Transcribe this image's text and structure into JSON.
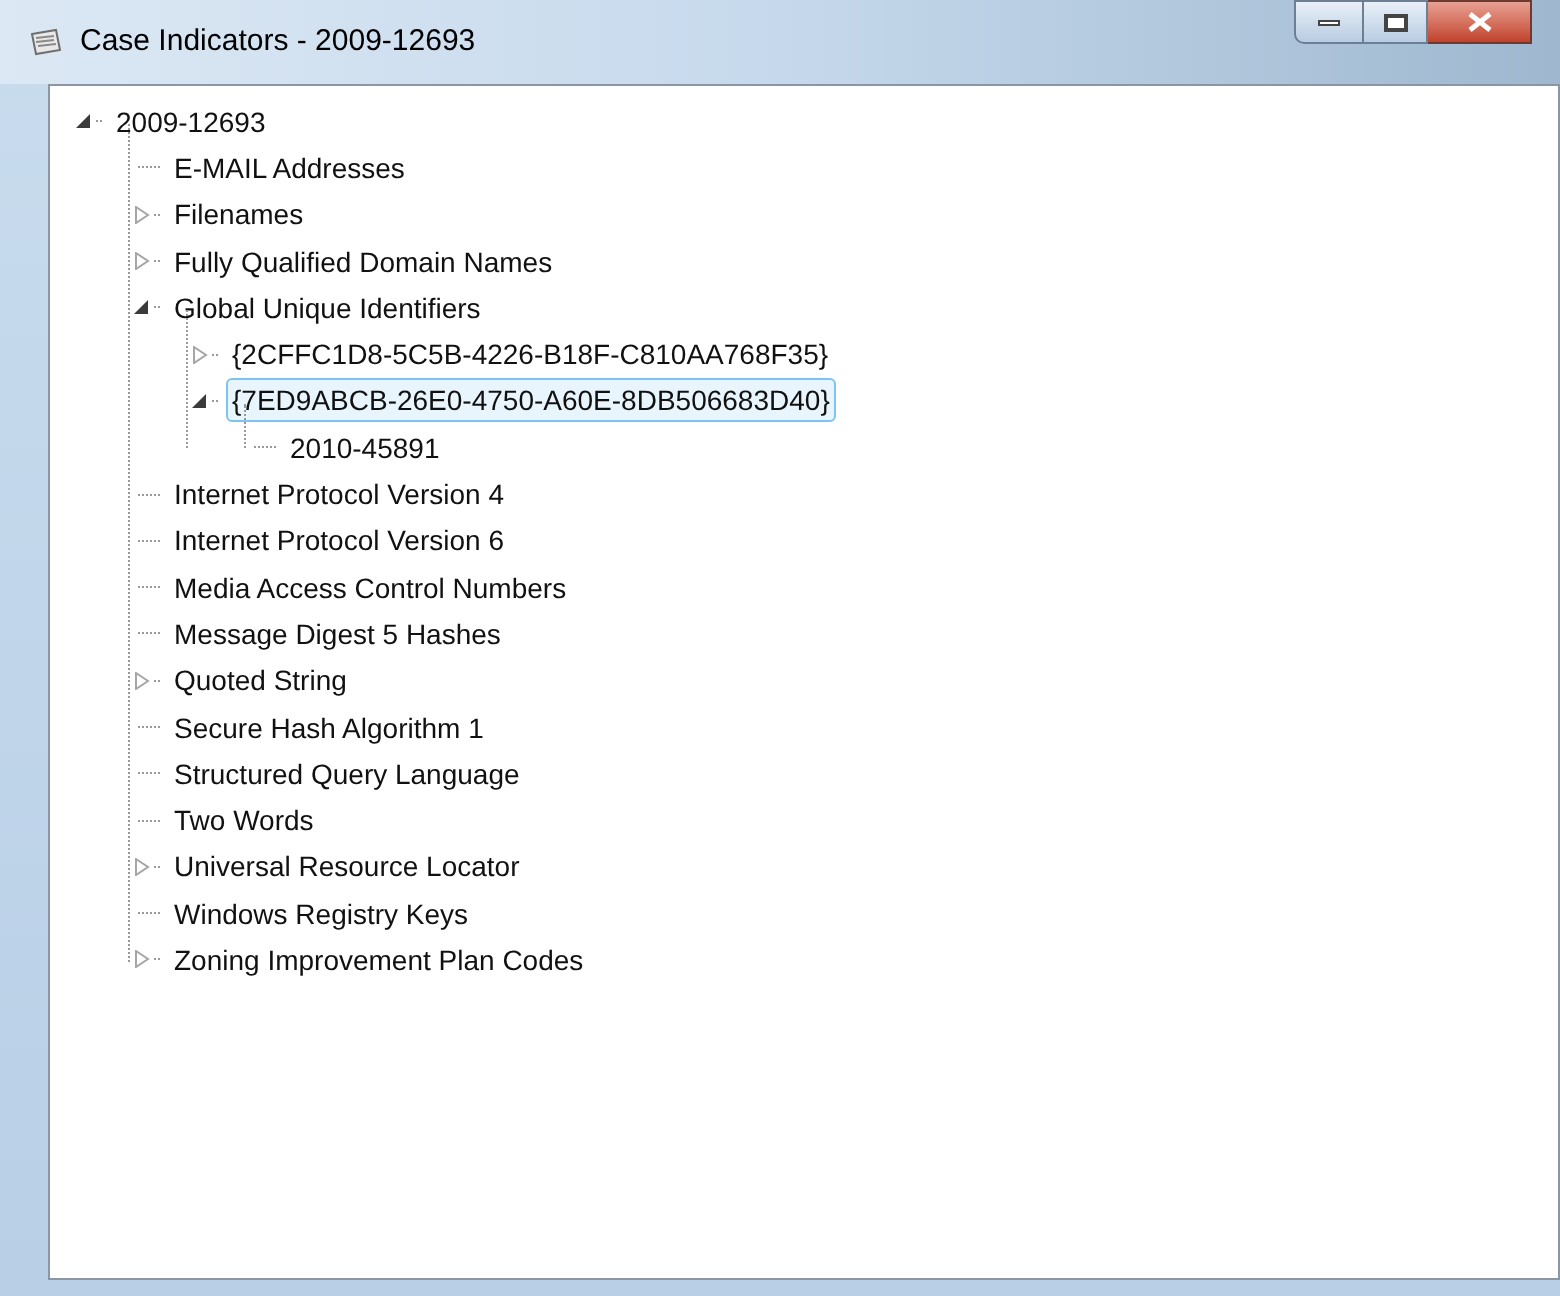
{
  "window": {
    "title": "Case Indicators - 2009-12693"
  },
  "tree": [
    {
      "label": "2009-12693",
      "kind": "group",
      "expanded": true,
      "selected": false,
      "children": [
        {
          "label": "E-MAIL Addresses",
          "kind": "leaf",
          "selected": false
        },
        {
          "label": "Filenames",
          "kind": "group",
          "expanded": false,
          "selected": false
        },
        {
          "label": "Fully Qualified Domain Names",
          "kind": "group",
          "expanded": false,
          "selected": false
        },
        {
          "label": "Global Unique Identifiers",
          "kind": "group",
          "expanded": true,
          "selected": false,
          "children": [
            {
              "label": "{2CFFC1D8-5C5B-4226-B18F-C810AA768F35}",
              "kind": "group",
              "expanded": false,
              "selected": false
            },
            {
              "label": "{7ED9ABCB-26E0-4750-A60E-8DB506683D40}",
              "kind": "group",
              "expanded": true,
              "selected": true,
              "children": [
                {
                  "label": "2010-45891",
                  "kind": "leaf",
                  "selected": false
                }
              ]
            }
          ]
        },
        {
          "label": "Internet Protocol Version 4",
          "kind": "leaf",
          "selected": false
        },
        {
          "label": "Internet Protocol Version 6",
          "kind": "leaf",
          "selected": false
        },
        {
          "label": "Media Access Control Numbers",
          "kind": "leaf",
          "selected": false
        },
        {
          "label": "Message Digest 5 Hashes",
          "kind": "leaf",
          "selected": false
        },
        {
          "label": "Quoted String",
          "kind": "group",
          "expanded": false,
          "selected": false
        },
        {
          "label": "Secure Hash Algorithm 1",
          "kind": "leaf",
          "selected": false
        },
        {
          "label": "Structured Query Language",
          "kind": "leaf",
          "selected": false
        },
        {
          "label": "Two Words",
          "kind": "leaf",
          "selected": false
        },
        {
          "label": "Universal Resource Locator",
          "kind": "group",
          "expanded": false,
          "selected": false
        },
        {
          "label": "Windows Registry Keys",
          "kind": "leaf",
          "selected": false
        },
        {
          "label": "Zoning Improvement Plan Codes",
          "kind": "group",
          "expanded": false,
          "selected": false
        }
      ]
    }
  ]
}
